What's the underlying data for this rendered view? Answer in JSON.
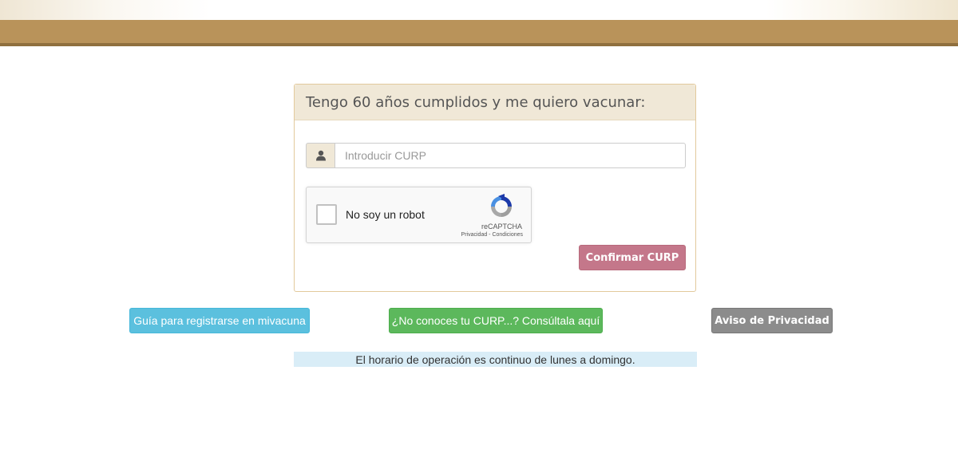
{
  "header": {
    "accent_color": "#b9935a"
  },
  "form": {
    "title": "Tengo 60 años cumplidos y me quiero vacunar:",
    "curp_input": {
      "placeholder": "Introducir CURP",
      "value": "",
      "icon": "user-icon"
    },
    "recaptcha": {
      "label": "No soy un robot",
      "brand": "reCAPTCHA",
      "privacy_link": "Privacidad",
      "separator": " - ",
      "terms_link": "Condiciones"
    },
    "confirm_label": "Confirmar CURP",
    "confirm_color": "#c4778a"
  },
  "actions": {
    "guide_label": "Guía para registrarse en mivacuna",
    "lookup_curp_label": "¿No conoces tu CURP...? Consúltala aquí",
    "privacy_label": "Aviso de Privacidad"
  },
  "notice": {
    "schedule_text": "El horario de operación es continuo de lunes a domingo."
  }
}
